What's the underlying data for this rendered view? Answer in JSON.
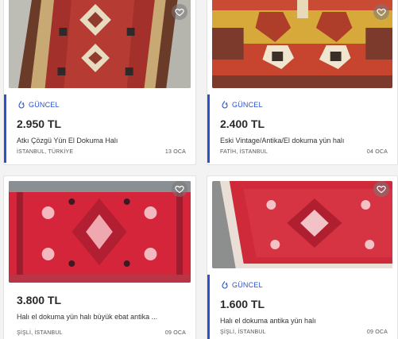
{
  "colors": {
    "accent": "#2d52c9",
    "fav_bg": "#787878"
  },
  "listings": [
    {
      "badge": "GÜNCEL",
      "price": "2.950 TL",
      "title": "Atkı Çözgü Yün El Dokuma Halı",
      "location": "İSTANBUL, TÜRKİYE",
      "date": "13 OCA",
      "image_icon": "rug-photo"
    },
    {
      "badge": "GÜNCEL",
      "price": "2.400 TL",
      "title": "Eski Vintage/Antika/El dokuma yün halı",
      "location": "FATİH, İSTANBUL",
      "date": "04 OCA",
      "image_icon": "rug-photo"
    },
    {
      "badge": "",
      "price": "3.800 TL",
      "title": "Halı el dokuma yün halı büyük ebat antika ...",
      "location": "ŞİŞLİ, İSTANBUL",
      "date": "09 OCA",
      "image_icon": "rug-photo"
    },
    {
      "badge": "GÜNCEL",
      "price": "1.600 TL",
      "title": "Halı el dokuma antika yün halı",
      "location": "ŞİŞLİ, İSTANBUL",
      "date": "09 OCA",
      "image_icon": "rug-photo"
    }
  ]
}
